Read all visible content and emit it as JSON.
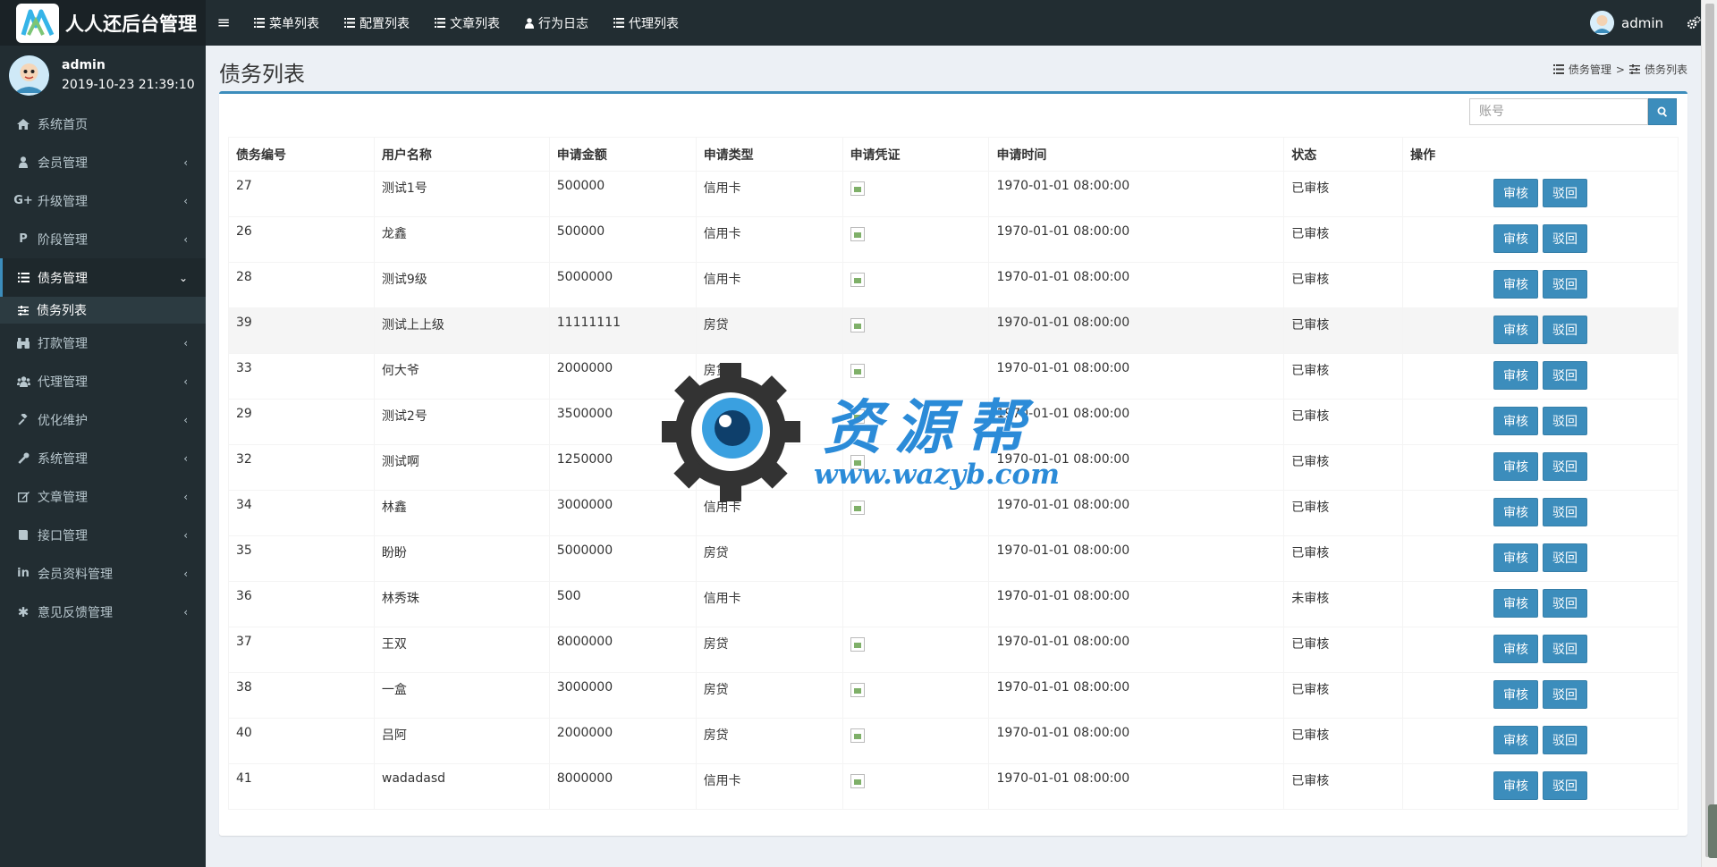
{
  "brand": {
    "title": "人人还后台管理"
  },
  "topnav": [
    {
      "label": "菜单列表",
      "icon": "list-icon"
    },
    {
      "label": "配置列表",
      "icon": "list-icon"
    },
    {
      "label": "文章列表",
      "icon": "list-icon"
    },
    {
      "label": "行为日志",
      "icon": "user-icon"
    },
    {
      "label": "代理列表",
      "icon": "list-icon"
    }
  ],
  "user": {
    "name": "admin",
    "time": "2019-10-23 21:39:10"
  },
  "sidebar": {
    "items": [
      {
        "label": "系统首页",
        "icon": "home-icon"
      },
      {
        "label": "会员管理",
        "icon": "user-icon"
      },
      {
        "label": "升级管理",
        "icon": "google-plus-icon"
      },
      {
        "label": "阶段管理",
        "icon": "pinterest-icon"
      },
      {
        "label": "债务管理",
        "icon": "list-icon",
        "active": true
      },
      {
        "label": "打款管理",
        "icon": "binoculars-icon"
      },
      {
        "label": "代理管理",
        "icon": "users-icon"
      },
      {
        "label": "优化维护",
        "icon": "gavel-icon"
      },
      {
        "label": "系统管理",
        "icon": "wrench-icon"
      },
      {
        "label": "文章管理",
        "icon": "edit-icon"
      },
      {
        "label": "接口管理",
        "icon": "book-icon"
      },
      {
        "label": "会员资料管理",
        "icon": "linkedin-icon"
      },
      {
        "label": "意见反馈管理",
        "icon": "asterisk-icon"
      }
    ],
    "submenu": {
      "label": "债务列表",
      "icon": "sliders-icon"
    }
  },
  "page": {
    "title": "债务列表"
  },
  "breadcrumb": {
    "parent": "债务管理",
    "separator": ">",
    "current": "债务列表"
  },
  "search": {
    "placeholder": "账号"
  },
  "table": {
    "headers": [
      "债务编号",
      "用户名称",
      "申请金额",
      "申请类型",
      "申请凭证",
      "申请时间",
      "状态",
      "操作"
    ],
    "approve_label": "审核",
    "reject_label": "驳回",
    "rows": [
      {
        "id": "27",
        "name": "测试1号",
        "amount": "500000",
        "type": "信用卡",
        "has_image": true,
        "time": "1970-01-01 08:00:00",
        "status": "已审核"
      },
      {
        "id": "26",
        "name": "龙鑫",
        "amount": "500000",
        "type": "信用卡",
        "has_image": true,
        "time": "1970-01-01 08:00:00",
        "status": "已审核"
      },
      {
        "id": "28",
        "name": "测试9级",
        "amount": "5000000",
        "type": "信用卡",
        "has_image": true,
        "time": "1970-01-01 08:00:00",
        "status": "已审核"
      },
      {
        "id": "39",
        "name": "测试上上级",
        "amount": "11111111",
        "type": "房贷",
        "has_image": true,
        "time": "1970-01-01 08:00:00",
        "status": "已审核",
        "highlight": true
      },
      {
        "id": "33",
        "name": "何大爷",
        "amount": "2000000",
        "type": "房贷",
        "has_image": true,
        "time": "1970-01-01 08:00:00",
        "status": "已审核"
      },
      {
        "id": "29",
        "name": "测试2号",
        "amount": "3500000",
        "type": "信用卡",
        "has_image": true,
        "time": "1970-01-01 08:00:00",
        "status": "已审核"
      },
      {
        "id": "32",
        "name": "测试啊",
        "amount": "1250000",
        "type": "房贷",
        "has_image": true,
        "time": "1970-01-01 08:00:00",
        "status": "已审核"
      },
      {
        "id": "34",
        "name": "林鑫",
        "amount": "3000000",
        "type": "信用卡",
        "has_image": true,
        "time": "1970-01-01 08:00:00",
        "status": "已审核"
      },
      {
        "id": "35",
        "name": "盼盼",
        "amount": "5000000",
        "type": "房贷",
        "has_image": false,
        "time": "1970-01-01 08:00:00",
        "status": "已审核"
      },
      {
        "id": "36",
        "name": "林秀珠",
        "amount": "500",
        "type": "信用卡",
        "has_image": false,
        "time": "1970-01-01 08:00:00",
        "status": "未审核"
      },
      {
        "id": "37",
        "name": "王双",
        "amount": "8000000",
        "type": "房贷",
        "has_image": true,
        "time": "1970-01-01 08:00:00",
        "status": "已审核"
      },
      {
        "id": "38",
        "name": "一盒",
        "amount": "3000000",
        "type": "房贷",
        "has_image": true,
        "time": "1970-01-01 08:00:00",
        "status": "已审核"
      },
      {
        "id": "40",
        "name": "吕阿",
        "amount": "2000000",
        "type": "房贷",
        "has_image": true,
        "time": "1970-01-01 08:00:00",
        "status": "已审核"
      },
      {
        "id": "41",
        "name": "wadadasd",
        "amount": "8000000",
        "type": "信用卡",
        "has_image": true,
        "time": "1970-01-01 08:00:00",
        "status": "已审核"
      }
    ]
  },
  "watermark": {
    "title": "资源帮",
    "url": "www.wazyb.com"
  },
  "colors": {
    "primary": "#3c8dbc",
    "sidebar": "#222d32",
    "content_bg": "#ecf0f5",
    "watermark": "#2b8bd8"
  }
}
